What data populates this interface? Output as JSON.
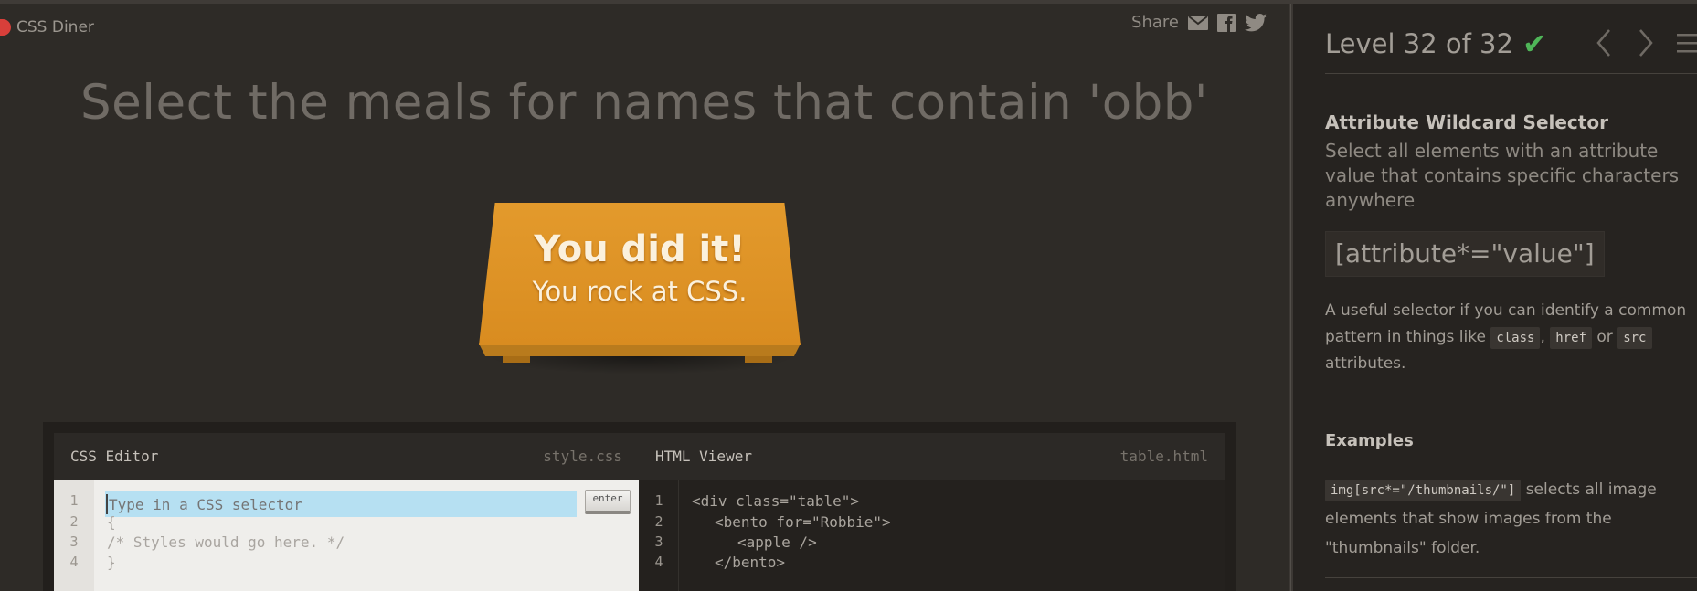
{
  "app": {
    "logo_text": "CSS Diner",
    "share_label": "Share"
  },
  "icons": {
    "share": [
      "mail-icon",
      "facebook-icon",
      "twitter-icon"
    ]
  },
  "instruction": "Select the meals for names that contain 'obb'",
  "success": {
    "title": "You did it!",
    "subtitle": "You rock at CSS."
  },
  "css_editor": {
    "title": "CSS Editor",
    "file": "style.css",
    "placeholder": "Type in a CSS selector",
    "enter_label": "enter",
    "line_numbers": [
      "1",
      "2",
      "3",
      "4"
    ],
    "lines": [
      "{",
      "/* Styles would go here. */",
      "}"
    ]
  },
  "html_viewer": {
    "title": "HTML Viewer",
    "file": "table.html",
    "line_numbers": [
      "1",
      "2",
      "3",
      "4"
    ],
    "lines": [
      "<div class=\"table\">",
      "<bento for=\"Robbie\">",
      "<apple />",
      "</bento>"
    ]
  },
  "sidebar": {
    "level": "Level 32 of 32",
    "title": "Attribute Wildcard Selector",
    "description": "Select all elements with an attribute value that contains specific characters anywhere",
    "syntax": "[attribute*=\"value\"]",
    "hint_pre": "A useful selector if you can identify a common pattern in things like",
    "hint_code1": "class",
    "hint_sep": ",",
    "hint_code2": "href",
    "hint_or": "or",
    "hint_code3": "src",
    "hint_post": "attributes.",
    "examples_title": "Examples",
    "example_code": "img[src*=\"/thumbnails/\"]",
    "example_text": "selects all image elements that show images from the \"thumbnails\" folder."
  },
  "colors": {
    "accent_check": "#4fb558",
    "table": "#e39a2c",
    "logo": "#d83f3a",
    "selector_highlight": "#b6e0f2"
  }
}
